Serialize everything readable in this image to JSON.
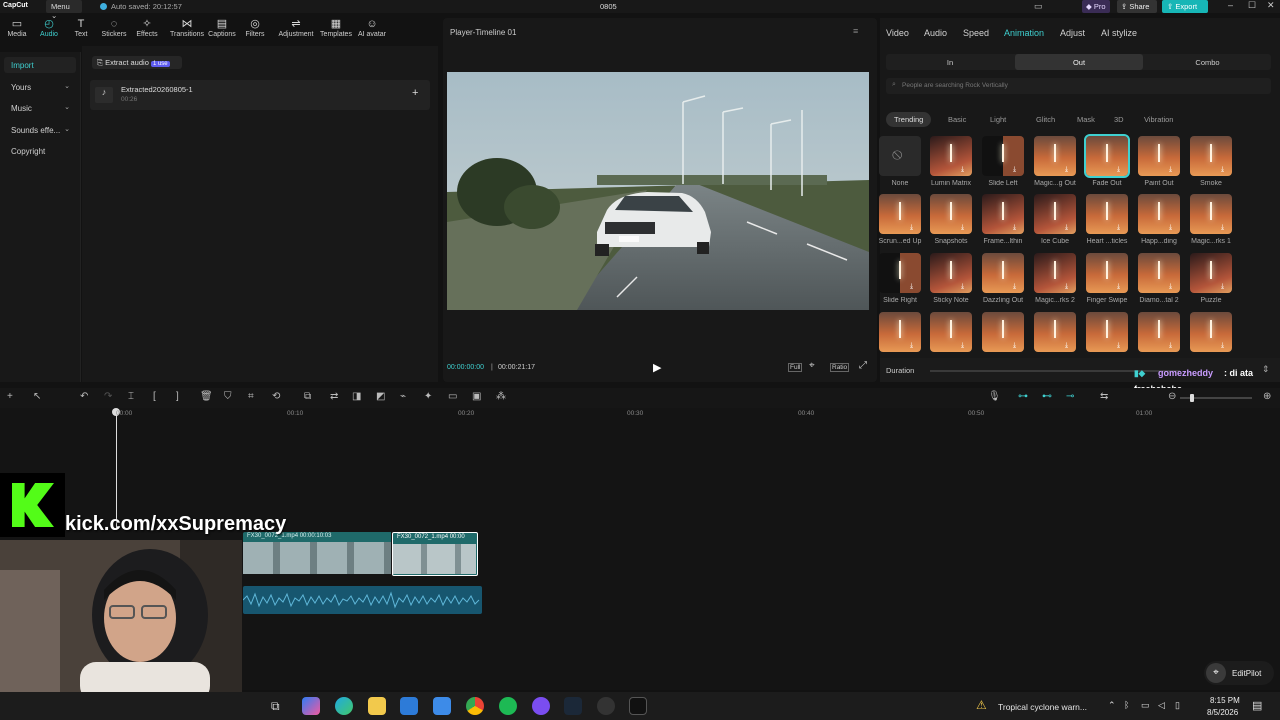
{
  "top": {
    "brand": "CapCut",
    "menu": "Menu",
    "autosave": "Auto saved: 20:12:57",
    "project": "0805",
    "pro": "Pro",
    "share": "Share",
    "export": "Export"
  },
  "toolbar": [
    {
      "label": "Media",
      "icon": "media-icon",
      "glyph": "▭"
    },
    {
      "label": "Audio",
      "icon": "audio-icon",
      "glyph": "◴"
    },
    {
      "label": "Text",
      "icon": "text-icon",
      "glyph": "T"
    },
    {
      "label": "Stickers",
      "icon": "sticker-icon",
      "glyph": "◌"
    },
    {
      "label": "Effects",
      "icon": "effects-icon",
      "glyph": "✧"
    },
    {
      "label": "Transitions",
      "icon": "transitions-icon",
      "glyph": "⋈"
    },
    {
      "label": "Captions",
      "icon": "captions-icon",
      "glyph": "▤"
    },
    {
      "label": "Filters",
      "icon": "filters-icon",
      "glyph": "◎"
    },
    {
      "label": "Adjustment",
      "icon": "adjustment-icon",
      "glyph": "⇌"
    },
    {
      "label": "Templates",
      "icon": "templates-icon",
      "glyph": "▦"
    },
    {
      "label": "AI avatar",
      "icon": "ai-avatar-icon",
      "glyph": "☺"
    }
  ],
  "leftnav": [
    {
      "label": "Import",
      "chevron": ""
    },
    {
      "label": "Yours",
      "chevron": "⌄"
    },
    {
      "label": "Music",
      "chevron": "⌄"
    },
    {
      "label": "Sounds effe...",
      "chevron": "⌄"
    },
    {
      "label": "Copyright",
      "chevron": ""
    }
  ],
  "library": {
    "extract_label": "Extract audio",
    "extract_badge": "1 use",
    "item_name": "Extracted20260805-1",
    "item_duration": "00:26"
  },
  "player": {
    "title": "Player-Timeline 01",
    "time_current": "00:00:00:00",
    "time_total": "00:00:21:17",
    "full": "Full",
    "ratio": "Ratio"
  },
  "right": {
    "tabs": [
      "Video",
      "Audio",
      "Speed",
      "Animation",
      "Adjust",
      "AI stylize"
    ],
    "subtabs": [
      "In",
      "Out",
      "Combo"
    ],
    "search_placeholder": "People are searching Rock Vertically",
    "chips": [
      "Trending",
      "Basic",
      "Light",
      "Glitch",
      "Mask",
      "3D",
      "Vibration"
    ],
    "tiles": [
      "None",
      "Lumin Matrix",
      "Slide Left",
      "Magic...g Out",
      "Fade Out",
      "Paint Out",
      "Smoke",
      "Scrun...ed Up",
      "Snapshots",
      "Frame...lthin",
      "Ice Cube",
      "Heart ...ticles",
      "Happ...ding",
      "Magic...rks 1",
      "Slide Right",
      "Sticky Note",
      "Dazzling Out",
      "Magic...rks 2",
      "Finger Swipe",
      "Diamo...tal 2",
      "Puzzle",
      "",
      "",
      "",
      "",
      "",
      "",
      ""
    ],
    "duration_label": "Duration"
  },
  "chat": {
    "user": "gomezheddy",
    "message": ": di ata",
    "line2": "freehahaha"
  },
  "timeline": {
    "ruler": [
      "00:00",
      "00:10",
      "00:20",
      "00:30",
      "00:40",
      "00:50",
      "01:00"
    ],
    "clip1": "FX30_0072_1.mp4   00:00:10:03",
    "clip2": "FX30_0072_1.mp4   00:00"
  },
  "overlay": {
    "kick_url": "kick.com/xxSupremacy"
  },
  "editpilot": "EditPilot",
  "taskbar": {
    "weather": "Tropical cyclone warn...",
    "time": "8:15 PM",
    "date": "8/5/2026"
  },
  "colors": {
    "accent": "#3fd0d0",
    "export": "#17b6b6",
    "kick": "#53fc18"
  }
}
